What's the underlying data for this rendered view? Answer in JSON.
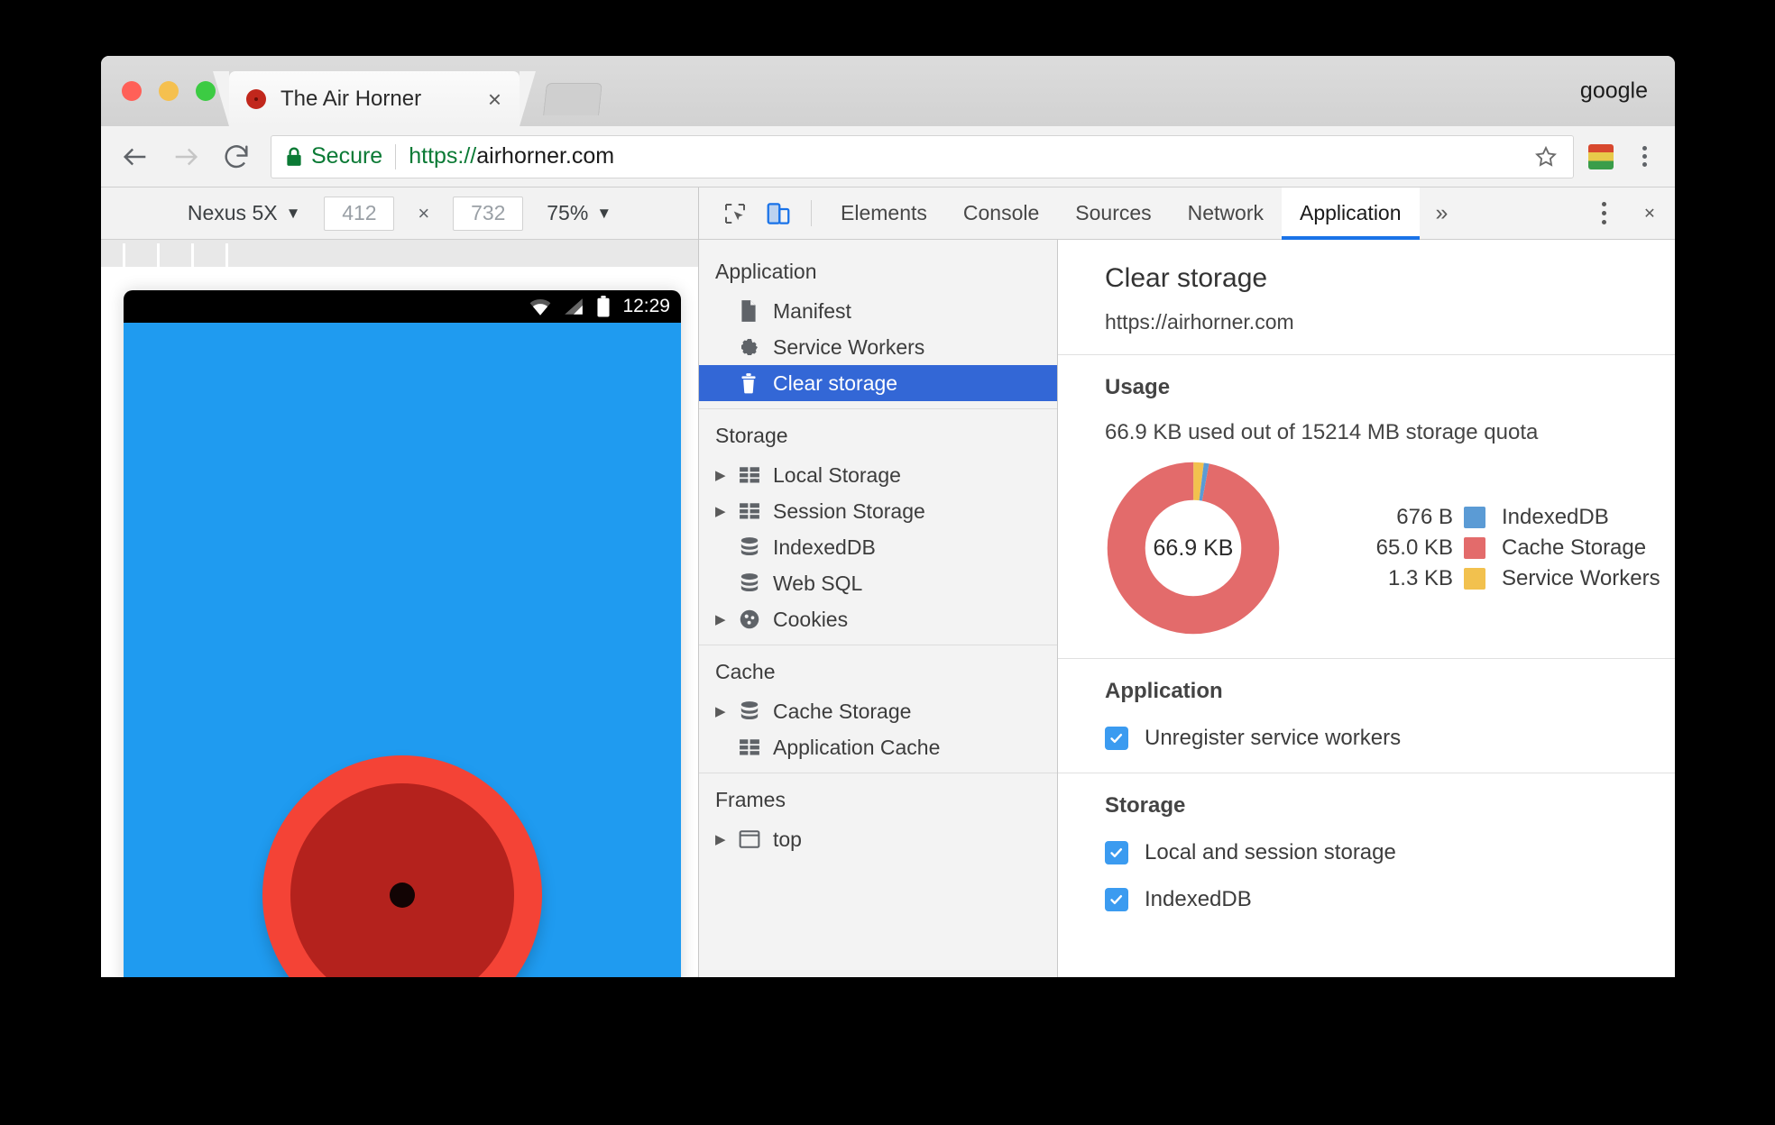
{
  "window": {
    "account_label": "google",
    "tab_title": "The Air Horner",
    "tab_close_glyph": "×",
    "favicon_name": "air-horner-favicon"
  },
  "omnibox": {
    "secure_label": "Secure",
    "url_scheme": "https://",
    "url_host": "airhorner.com",
    "url_full": "https://airhorner.com"
  },
  "device_toolbar": {
    "device_name": "Nexus 5X",
    "caret": "▼",
    "width": "412",
    "height": "732",
    "times": "×",
    "zoom": "75%"
  },
  "device_screen": {
    "status_time": "12:29",
    "horn_button_name": "air-horn-button",
    "bg_color": "#1f9bf0",
    "horn_outer_color": "#f44336",
    "horn_inner_color": "#b4221d"
  },
  "devtools": {
    "tabs": [
      {
        "label": "Elements",
        "selected": false
      },
      {
        "label": "Console",
        "selected": false
      },
      {
        "label": "Sources",
        "selected": false
      },
      {
        "label": "Network",
        "selected": false
      },
      {
        "label": "Application",
        "selected": true
      }
    ],
    "more_tabs_glyph": "»",
    "close_glyph": "✕",
    "accent_color": "#1a73e8"
  },
  "sidebar": {
    "sections": [
      {
        "title": "Application",
        "items": [
          {
            "label": "Manifest",
            "icon": "manifest-document-icon",
            "twisty": "",
            "selected": false
          },
          {
            "label": "Service Workers",
            "icon": "gear-icon",
            "twisty": "",
            "selected": false
          },
          {
            "label": "Clear storage",
            "icon": "trash-icon",
            "twisty": "",
            "selected": true
          }
        ]
      },
      {
        "title": "Storage",
        "items": [
          {
            "label": "Local Storage",
            "icon": "table-icon",
            "twisty": "▶",
            "selected": false
          },
          {
            "label": "Session Storage",
            "icon": "table-icon",
            "twisty": "▶",
            "selected": false
          },
          {
            "label": "IndexedDB",
            "icon": "database-icon",
            "twisty": "",
            "selected": false
          },
          {
            "label": "Web SQL",
            "icon": "database-icon",
            "twisty": "",
            "selected": false
          },
          {
            "label": "Cookies",
            "icon": "cookie-icon",
            "twisty": "▶",
            "selected": false
          }
        ]
      },
      {
        "title": "Cache",
        "items": [
          {
            "label": "Cache Storage",
            "icon": "database-icon",
            "twisty": "▶",
            "selected": false
          },
          {
            "label": "Application Cache",
            "icon": "table-icon",
            "twisty": "",
            "selected": false
          }
        ]
      },
      {
        "title": "Frames",
        "items": [
          {
            "label": "top",
            "icon": "frame-icon",
            "twisty": "▶",
            "selected": false
          }
        ]
      }
    ]
  },
  "clear_storage": {
    "title": "Clear storage",
    "origin": "https://airhorner.com",
    "usage": {
      "heading": "Usage",
      "summary": "66.9 KB used out of 15214 MB storage quota",
      "center_label": "66.9 KB"
    },
    "application": {
      "heading": "Application",
      "options": [
        {
          "label": "Unregister service workers",
          "checked": true
        }
      ]
    },
    "storage": {
      "heading": "Storage",
      "options": [
        {
          "label": "Local and session storage",
          "checked": true
        },
        {
          "label": "IndexedDB",
          "checked": true
        }
      ]
    }
  },
  "chart_data": {
    "type": "pie",
    "title": "Usage",
    "subtitle": "66.9 KB used out of 15214 MB storage quota",
    "center_label": "66.9 KB",
    "donut": true,
    "total_bytes": 66900,
    "total_label": "66.9 KB",
    "quota_label": "15214 MB",
    "legend_position": "right",
    "categories": [
      "IndexedDB",
      "Cache Storage",
      "Service Workers"
    ],
    "values": [
      676,
      66560,
      1331
    ],
    "value_labels": [
      "676 B",
      "65.0 KB",
      "1.3 KB"
    ],
    "colors": [
      "#5b9bd5",
      "#e36b6b",
      "#f2c14e"
    ],
    "slices": [
      {
        "name": "IndexedDB",
        "label": "676 B",
        "bytes": 676,
        "percent": 1.0,
        "color": "#5b9bd5"
      },
      {
        "name": "Cache Storage",
        "label": "65.0 KB",
        "bytes": 66560,
        "percent": 97.0,
        "color": "#e36b6b"
      },
      {
        "name": "Service Workers",
        "label": "1.3 KB",
        "bytes": 1331,
        "percent": 2.0,
        "color": "#f2c14e"
      }
    ]
  }
}
